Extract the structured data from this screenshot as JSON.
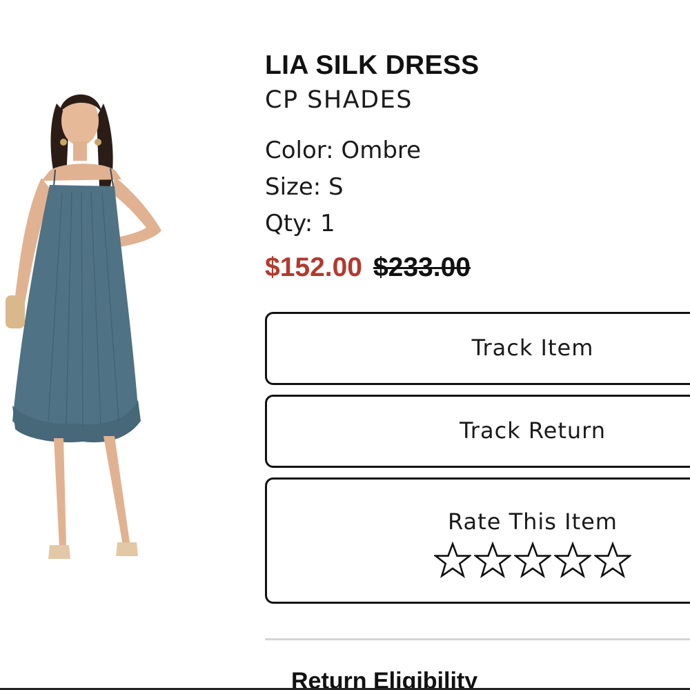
{
  "product": {
    "name": "LIA SILK DRESS",
    "brand": "CP SHADES",
    "image_alt": "Model wearing blue pleated slip dress",
    "attributes": [
      {
        "label": "Color:",
        "value": "Ombre"
      },
      {
        "label": "Size:",
        "value": "S"
      },
      {
        "label": "Qty:",
        "value": "1"
      }
    ],
    "attribute_lines": [
      "Color: Ombre",
      "Size: S",
      "Qty: 1"
    ],
    "sale_price": "$152.00",
    "original_price": "$233.00"
  },
  "actions": {
    "track_item_label": "Track Item",
    "track_return_label": "Track Return",
    "rate_label": "Rate This Item",
    "rating": {
      "value": 0,
      "max": 5,
      "icon": "star-outline-icon"
    }
  },
  "sections": {
    "return_eligibility_heading": "Return Eligibility"
  },
  "colors": {
    "sale_price": "#b23a2e",
    "text": "#111111",
    "divider": "#d4d4d4",
    "dress": "#4f7285"
  }
}
